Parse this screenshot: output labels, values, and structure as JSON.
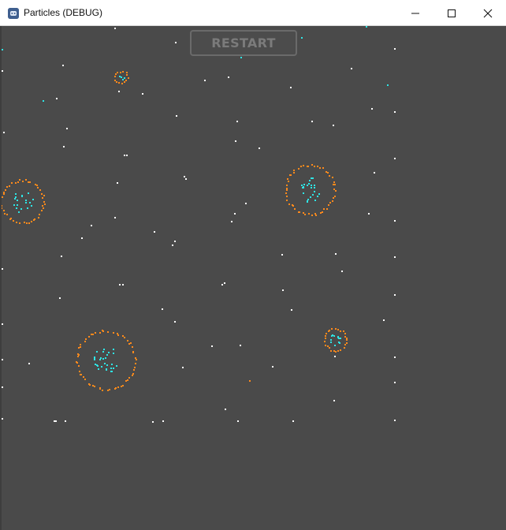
{
  "window": {
    "title": "Particles (DEBUG)",
    "icon": "godot-engine-icon"
  },
  "controls": {
    "minimize_icon": "minimize-icon",
    "maximize_icon": "maximize-icon",
    "close_icon": "close-icon"
  },
  "game": {
    "restart_label": "RESTART",
    "background_color": "#4a4a4a",
    "colors": {
      "star": "#ffffff",
      "ring": "#ff8a1c",
      "core": "#2ee6e6"
    }
  }
}
